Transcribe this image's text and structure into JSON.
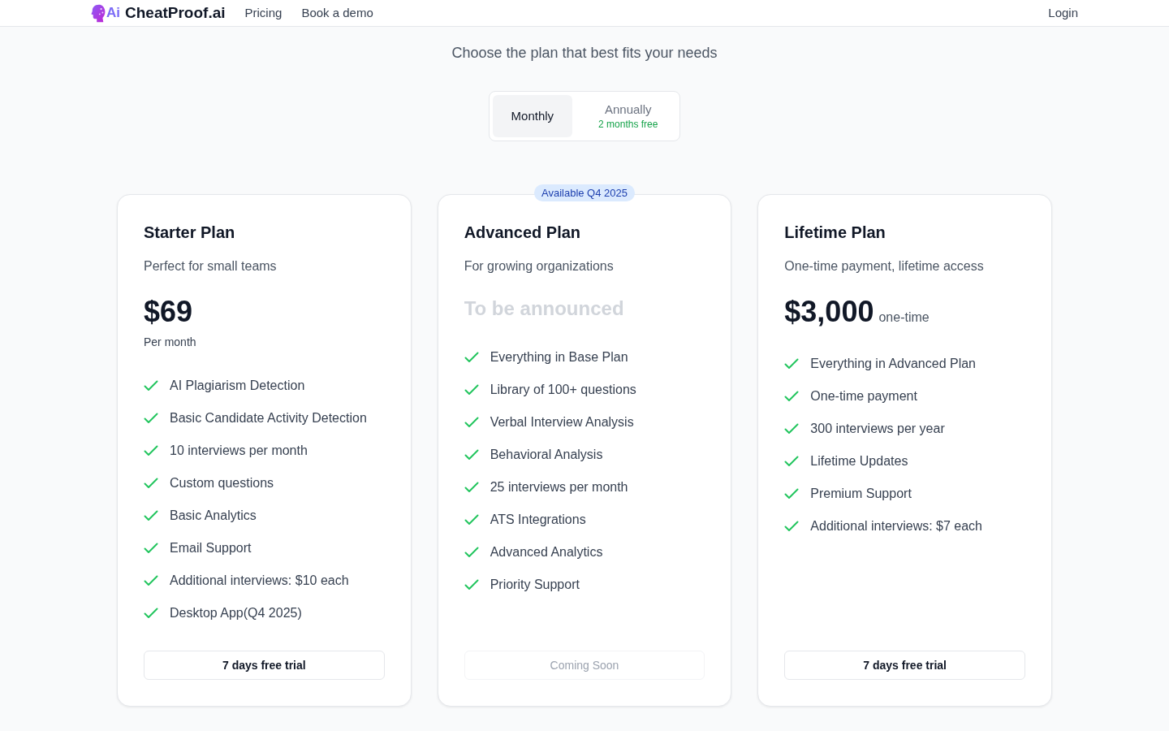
{
  "header": {
    "brand_mark": "Ai",
    "brand": "CheatProof.ai",
    "nav": [
      {
        "label": "Pricing"
      },
      {
        "label": "Book a demo"
      }
    ],
    "login": "Login"
  },
  "subtitle": "Choose the plan that best fits your needs",
  "billing_toggle": [
    {
      "label": "Monthly",
      "selected": true
    },
    {
      "label": "Annually",
      "note": "2 months free",
      "selected": false
    }
  ],
  "plans": [
    {
      "name": "Starter Plan",
      "description": "Perfect for small teams",
      "price": "$69",
      "price_muted": false,
      "period": "Per month",
      "features": [
        "AI Plagiarism Detection",
        "Basic Candidate Activity Detection",
        "10 interviews per month",
        "Custom questions",
        "Basic Analytics",
        "Email Support",
        "Additional interviews: $10 each",
        "Desktop App(Q4 2025)"
      ],
      "button": {
        "label": "7 days free trial",
        "disabled": false
      }
    },
    {
      "badge": "Available Q4 2025",
      "name": "Advanced Plan",
      "description": "For growing organizations",
      "price": "To be announced",
      "price_muted": true,
      "features": [
        "Everything in Base Plan",
        "Library of 100+ questions",
        "Verbal Interview Analysis",
        "Behavioral Analysis",
        "25 interviews per month",
        "ATS Integrations",
        "Advanced Analytics",
        "Priority Support"
      ],
      "button": {
        "label": "Coming Soon",
        "disabled": true
      }
    },
    {
      "name": "Lifetime Plan",
      "description": "One-time payment, lifetime access",
      "price": "$3,000",
      "price_muted": false,
      "price_suffix": "one-time",
      "features": [
        "Everything in Advanced Plan",
        "One-time payment",
        "300 interviews per year",
        "Lifetime Updates",
        "Premium Support",
        "Additional interviews: $7 each"
      ],
      "button": {
        "label": "7 days free trial",
        "disabled": false
      }
    }
  ]
}
